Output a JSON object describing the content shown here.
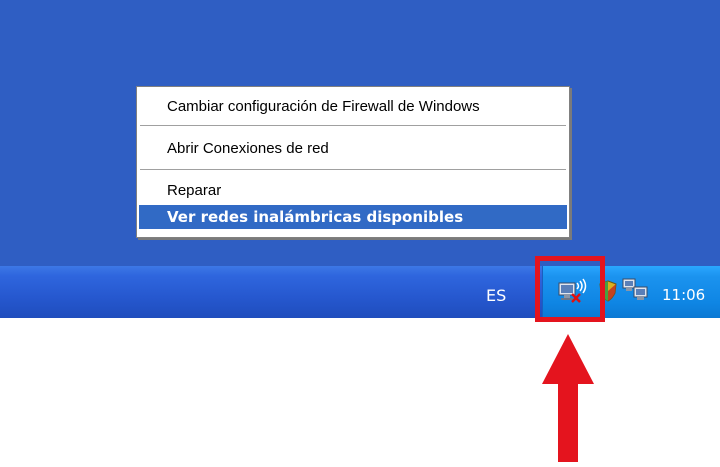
{
  "context_menu": {
    "items": [
      {
        "label": "Cambiar configuración de Firewall de Windows"
      },
      {
        "label": "Abrir Conexiones de red"
      },
      {
        "label": "Reparar"
      },
      {
        "label": "Ver redes inalámbricas disponibles",
        "default": true,
        "highlighted": true
      }
    ]
  },
  "taskbar": {
    "language": "ES",
    "clock": "11:06",
    "tray_icons": [
      "wireless-network-disconnected-icon",
      "shield-warning-icon",
      "network-connections-icon"
    ]
  },
  "colors": {
    "desktop": "#2f5ec3",
    "menu_highlight": "#316ac5",
    "callout_red": "#e4141e"
  }
}
